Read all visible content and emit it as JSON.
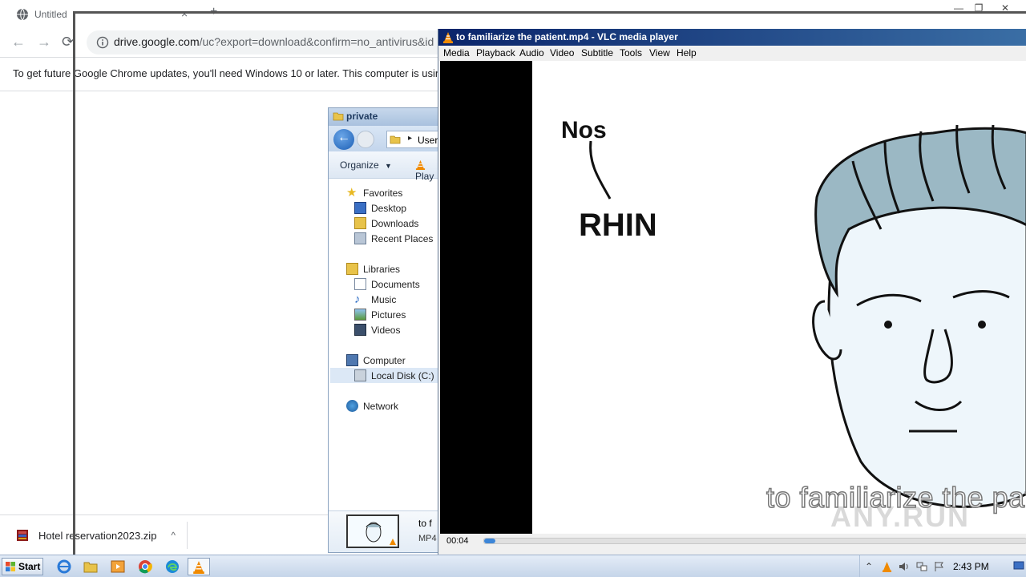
{
  "chrome": {
    "tab_title": "Untitled",
    "tab_close": "×",
    "new_tab": "+",
    "win_min": "—",
    "win_max": "❐",
    "win_close": "✕",
    "back": "←",
    "forward": "→",
    "reload": "⟳",
    "url_host": "drive.google.com",
    "url_path": "/uc?export=download&confirm=no_antivirus&id",
    "infobar_text": "To get future Google Chrome updates, you'll need Windows 10 or later. This computer is using W",
    "download": {
      "filename": "Hotel reservation2023.zip",
      "caret": "^"
    }
  },
  "explorer": {
    "title": "private",
    "address": "User",
    "toolbar": {
      "organize": "Organize",
      "organize_caret": "▼",
      "play": "Play"
    },
    "nav": {
      "favorites": "Favorites",
      "desktop": "Desktop",
      "downloads": "Downloads",
      "recent_places": "Recent Places",
      "libraries": "Libraries",
      "documents": "Documents",
      "music": "Music",
      "pictures": "Pictures",
      "videos": "Videos",
      "computer": "Computer",
      "local_disk": "Local Disk (C:)",
      "network": "Network"
    },
    "details": {
      "name": "to f",
      "type": "MP4"
    }
  },
  "vlc": {
    "title": "to familiarize the patient.mp4 - VLC media player",
    "menu": [
      "Media",
      "Playback",
      "Audio",
      "Video",
      "Subtitle",
      "Tools",
      "View",
      "Help"
    ],
    "video": {
      "drawn_text_1": "Nos",
      "drawn_text_2": "RHIN",
      "subtitle": "to familiarize the pat",
      "watermark": "ANY.RUN"
    },
    "time_elapsed": "00:04",
    "progress_fraction": 0.02
  },
  "taskbar": {
    "start_label": "Start",
    "tray_expand": "⌃",
    "clock": "2:43 PM"
  },
  "colors": {
    "vlc_title_gradient_start": "#0a246a",
    "vlc_title_gradient_end": "#3a6ea5",
    "hair": "#9bb8c4",
    "skin": "#eef6fb",
    "seek_fill": "#3d86d8"
  }
}
